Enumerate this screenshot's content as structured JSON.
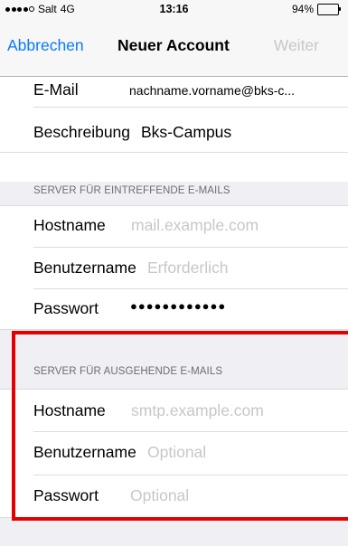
{
  "status": {
    "carrier": "Salt",
    "network": "4G",
    "time": "13:16",
    "battery": "94%",
    "battery_level": 0.94
  },
  "nav": {
    "cancel": "Abbrechen",
    "title": "Neuer Account",
    "next": "Weiter"
  },
  "account": {
    "email_label": "E-Mail",
    "email_value": "nachname.vorname@bks-c...",
    "description_label": "Beschreibung",
    "description_value": "Bks-Campus"
  },
  "incoming": {
    "header": "SERVER FÜR EINTREFFENDE E-MAILS",
    "hostname_label": "Hostname",
    "hostname_placeholder": "mail.example.com",
    "username_label": "Benutzername",
    "username_placeholder": "Erforderlich",
    "password_label": "Passwort",
    "password_value": "●●●●●●●●●●●●"
  },
  "outgoing": {
    "header": "SERVER FÜR AUSGEHENDE E-MAILS",
    "hostname_label": "Hostname",
    "hostname_placeholder": "smtp.example.com",
    "username_label": "Benutzername",
    "username_placeholder": "Optional",
    "password_label": "Passwort",
    "password_placeholder": "Optional"
  },
  "colors": {
    "accent": "#0a7aff",
    "placeholder": "#c7c7cc",
    "highlight": "#e50000"
  }
}
